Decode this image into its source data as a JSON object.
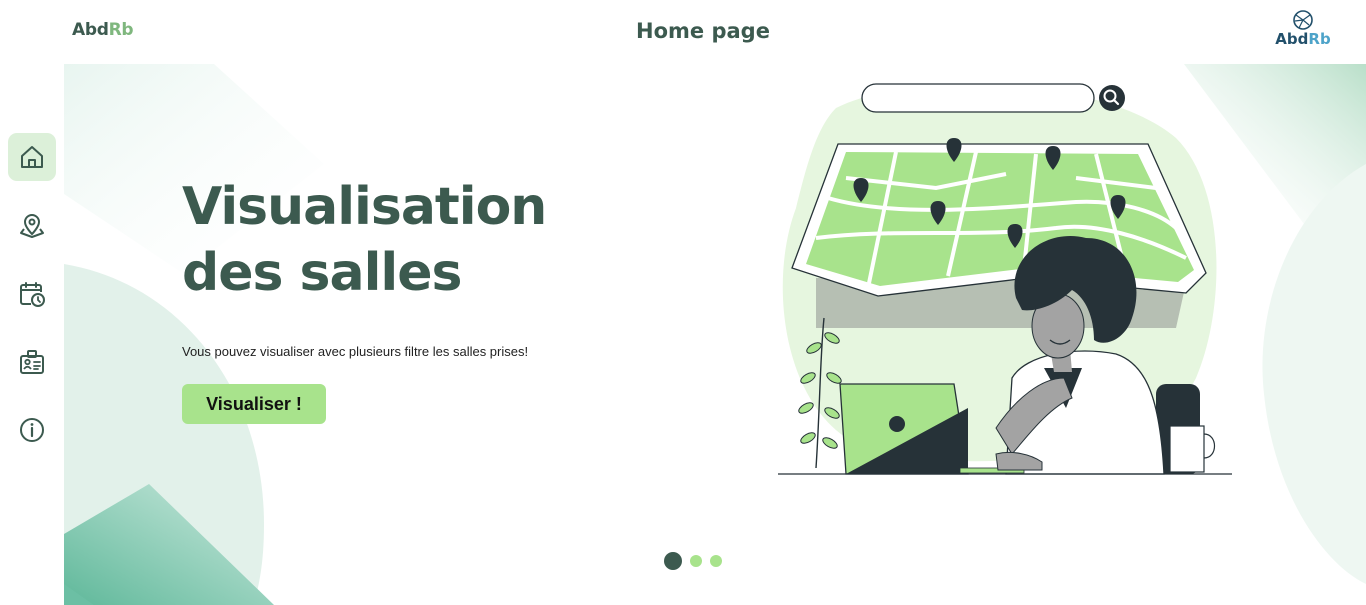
{
  "header": {
    "brand_left": {
      "part1": "Abd",
      "part2": "Rb"
    },
    "title": "Home page",
    "brand_right": {
      "part1": "Abd",
      "part2": "Rb"
    }
  },
  "sidebar": {
    "items": [
      {
        "name": "home",
        "icon": "home-icon",
        "active": true
      },
      {
        "name": "map",
        "icon": "map-pin-icon",
        "active": false
      },
      {
        "name": "calendar",
        "icon": "calendar-clock-icon",
        "active": false
      },
      {
        "name": "id-card",
        "icon": "id-badge-icon",
        "active": false
      },
      {
        "name": "info",
        "icon": "info-icon",
        "active": false
      }
    ]
  },
  "hero": {
    "title_line1": "Visualisation",
    "title_line2": "des salles",
    "subtitle": "Vous pouvez visualiser avec plusieurs filtre les salles prises!",
    "cta_label": "Visualiser !"
  },
  "carousel": {
    "count": 3,
    "active_index": 0
  },
  "colors": {
    "primary": "#3c5a4f",
    "accent": "#a8e38c",
    "accent_bg": "#dcf0d9",
    "brand_blue": "#22506b"
  }
}
